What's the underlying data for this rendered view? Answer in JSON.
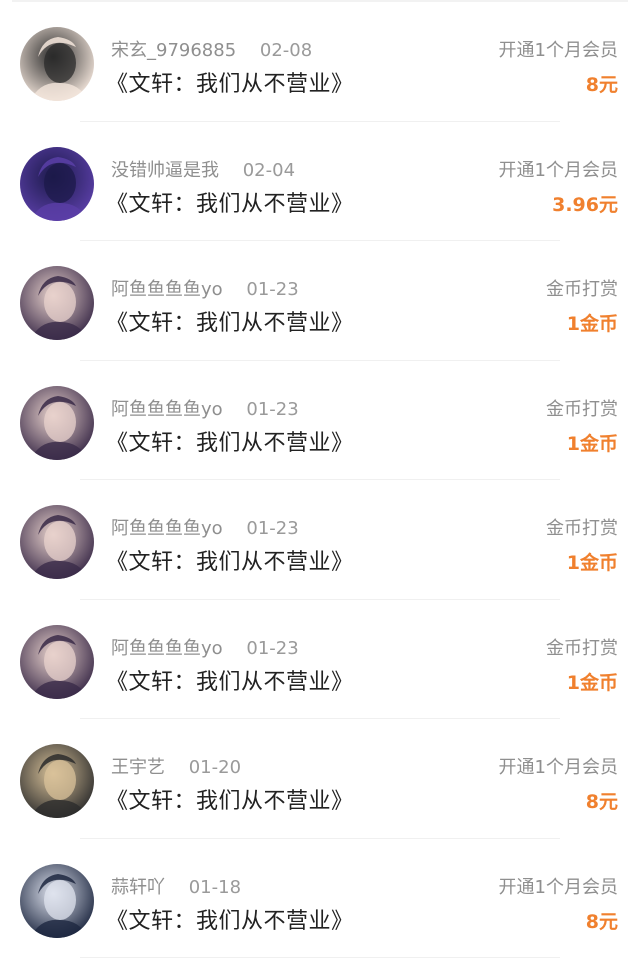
{
  "records": [
    {
      "user": "宋玄_9796885",
      "date": "02-08",
      "title": "《文轩：我们从不营业》",
      "type": "开通1个月会员",
      "amount": "8元",
      "avatar_icon": "avatar-photo-icon",
      "avatar_colors": [
        "#f4e6dc",
        "#2b2b2b"
      ]
    },
    {
      "user": "没错帅逼是我",
      "date": "02-04",
      "title": "《文轩：我们从不营业》",
      "type": "开通1个月会员",
      "amount": "3.96元",
      "avatar_icon": "avatar-anime-icon",
      "avatar_colors": [
        "#5b3fa8",
        "#1c1a4a"
      ]
    },
    {
      "user": "阿鱼鱼鱼鱼yo",
      "date": "01-23",
      "title": "《文轩：我们从不营业》",
      "type": "金币打赏",
      "amount": "1金币",
      "avatar_icon": "avatar-photo-icon",
      "avatar_colors": [
        "#3a2a48",
        "#e8d2cc"
      ]
    },
    {
      "user": "阿鱼鱼鱼鱼yo",
      "date": "01-23",
      "title": "《文轩：我们从不营业》",
      "type": "金币打赏",
      "amount": "1金币",
      "avatar_icon": "avatar-photo-icon",
      "avatar_colors": [
        "#3a2a48",
        "#e8d2cc"
      ]
    },
    {
      "user": "阿鱼鱼鱼鱼yo",
      "date": "01-23",
      "title": "《文轩：我们从不营业》",
      "type": "金币打赏",
      "amount": "1金币",
      "avatar_icon": "avatar-photo-icon",
      "avatar_colors": [
        "#3a2a48",
        "#e8d2cc"
      ]
    },
    {
      "user": "阿鱼鱼鱼鱼yo",
      "date": "01-23",
      "title": "《文轩：我们从不营业》",
      "type": "金币打赏",
      "amount": "1金币",
      "avatar_icon": "avatar-photo-icon",
      "avatar_colors": [
        "#3a2a48",
        "#e8d2cc"
      ]
    },
    {
      "user": "王宇艺",
      "date": "01-20",
      "title": "《文轩：我们从不营业》",
      "type": "开通1个月会员",
      "amount": "8元",
      "avatar_icon": "avatar-photo-icon",
      "avatar_colors": [
        "#2c2c2c",
        "#d9c29a"
      ]
    },
    {
      "user": "蒜轩吖",
      "date": "01-18",
      "title": "《文轩：我们从不营业》",
      "type": "开通1个月会员",
      "amount": "8元",
      "avatar_icon": "avatar-photo-icon",
      "avatar_colors": [
        "#1d2740",
        "#dfe3ee"
      ]
    }
  ],
  "colors": {
    "amount": "#f0802e",
    "secondary_text": "#8f8f8f",
    "title_text": "#222222",
    "divider": "#f0f0f0"
  }
}
